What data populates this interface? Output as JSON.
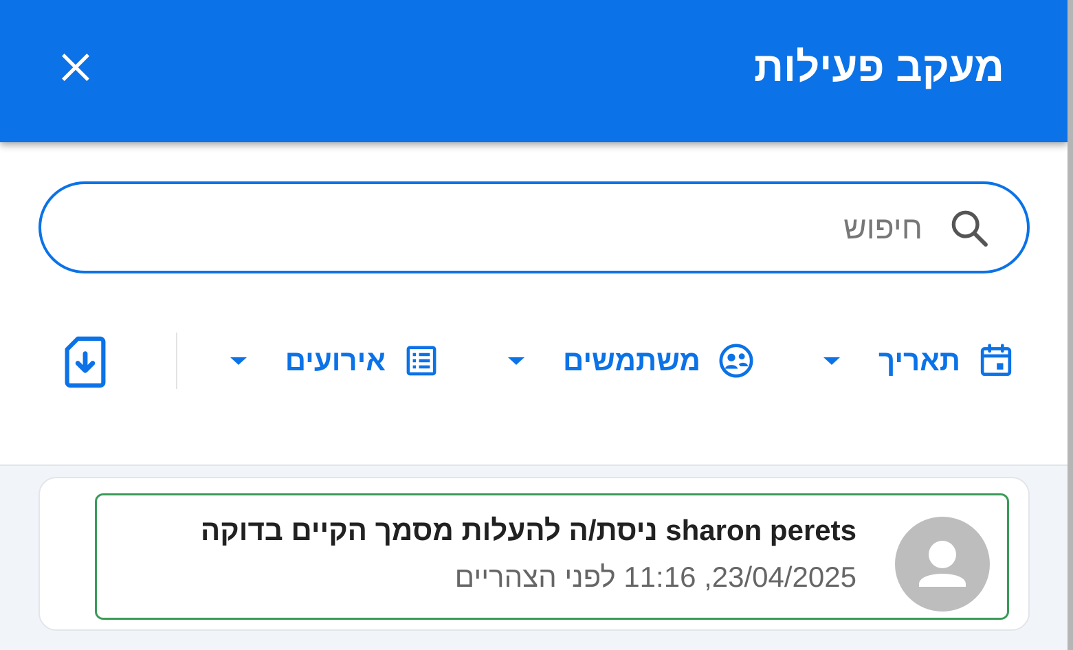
{
  "header": {
    "title": "מעקב פעילות",
    "close_icon": "close-icon",
    "background_color": "#0b72e7"
  },
  "search": {
    "placeholder": "חיפוש",
    "value": "",
    "icon": "search-icon"
  },
  "filters": [
    {
      "label": "תאריך",
      "icon": "calendar-icon"
    },
    {
      "label": "משתמשים",
      "icon": "users-icon"
    },
    {
      "label": "אירועים",
      "icon": "list-icon"
    }
  ],
  "export": {
    "icon": "file-download-icon"
  },
  "activity": [
    {
      "title": "sharon perets ניסת/ה להעלות מסמך הקיים בדוקה",
      "time": "23/04/2025, 11:16 לפני הצהריים",
      "avatar_icon": "person-icon"
    }
  ],
  "colors": {
    "accent": "#0b72e7",
    "highlight_border": "#3a9a58",
    "avatar_bg": "#bdbdbd"
  }
}
